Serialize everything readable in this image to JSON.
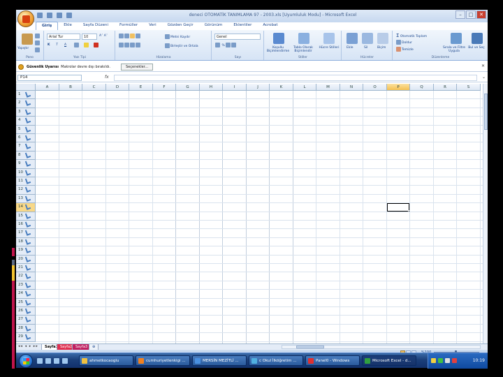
{
  "window": {
    "title": "deneci OTOMATİK TANIMLAMA 97 - 2003.xls [Uyumluluk Modu] - Microsoft Excel",
    "controls": [
      "–",
      "□",
      "✕"
    ]
  },
  "ribbon_tabs": [
    "Giriş",
    "Ekle",
    "Sayfa Düzeni",
    "Formüller",
    "Veri",
    "Gözden Geçir",
    "Görünüm",
    "Eklentiler",
    "Acrobat"
  ],
  "ribbon": {
    "clipboard": {
      "paste": "Yapıştır",
      "label": "Pano"
    },
    "font": {
      "name": "Arial Tur",
      "size": "10",
      "bold": "K",
      "italic": "T",
      "underline": "A",
      "label": "Yazı Tipi"
    },
    "alignment": {
      "wrap": "Metni Kaydır",
      "merge": "Birleştir ve Ortala",
      "label": "Hizalama"
    },
    "number": {
      "format": "Genel",
      "percent": "%",
      "label": "Sayı"
    },
    "styles": {
      "conditional": "Koşullu Biçimlendirme",
      "table": "Tablo Olarak Biçimlendir",
      "cell": "Hücre Stilleri",
      "label": "Stiller"
    },
    "cells": {
      "insert": "Ekle",
      "delete": "Sil",
      "format": "Biçim",
      "label": "Hücreler"
    },
    "editing": {
      "autosum": "Otomatik Toplam",
      "fill": "Doldur",
      "clear": "Temizle",
      "sort": "Sırala ve Filtre Uygula",
      "find": "Bul ve Seç",
      "label": "Düzenleme"
    }
  },
  "security_bar": {
    "title": "Güvenlik Uyarısı",
    "message": "Makrolar devre dışı bırakıldı.",
    "options_button": "Seçenekler..."
  },
  "formula_bar": {
    "name_box": "P14",
    "fx": "fx",
    "value": ""
  },
  "sheet": {
    "columns": [
      "A",
      "B",
      "C",
      "D",
      "E",
      "F",
      "G",
      "H",
      "I",
      "J",
      "K",
      "L",
      "M",
      "N",
      "O",
      "P",
      "Q",
      "R",
      "S"
    ],
    "rows": [
      "1",
      "2",
      "3",
      "4",
      "5",
      "6",
      "7",
      "8",
      "9",
      "10",
      "11",
      "12",
      "13",
      "14",
      "15",
      "16",
      "17",
      "18",
      "19",
      "20",
      "21",
      "22",
      "23",
      "24",
      "25",
      "26",
      "27",
      "28",
      "29"
    ],
    "active_cell": "P14",
    "tabs": [
      "Sayfa1",
      "Sayfa2",
      "Sayfa3"
    ]
  },
  "status_bar": {
    "zoom": "%100"
  },
  "taskbar": {
    "tasks": [
      "ahmetkocaoglu",
      "cumhuriyetlenkigi ...",
      "MERSİN MEZİTLİ ...",
      "c Okul İlköğretim ...",
      "Panel0 - Windows",
      "Microsoft Excel - d..."
    ],
    "clock": "10:19"
  },
  "colors": {
    "selected_header": "#f5c050",
    "ribbon": "#d6e4f5",
    "taskbar": "#1b3f7a"
  }
}
